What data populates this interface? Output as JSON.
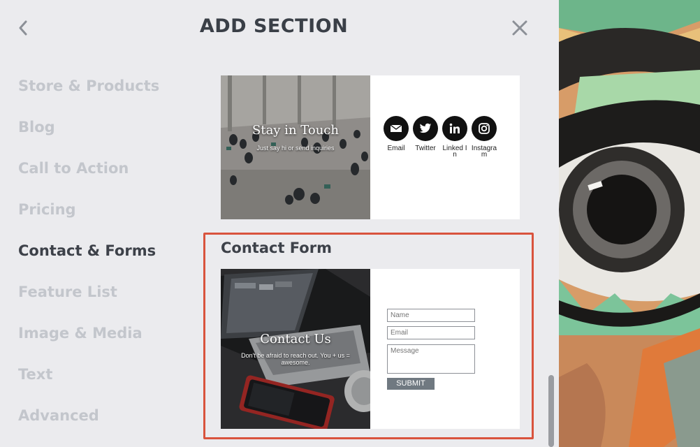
{
  "header": {
    "title": "ADD SECTION",
    "back_icon": "chevron-left-icon",
    "close_icon": "close-icon"
  },
  "categories": [
    {
      "label": "Store & Products",
      "active": false
    },
    {
      "label": "Blog",
      "active": false
    },
    {
      "label": "Call to Action",
      "active": false
    },
    {
      "label": "Pricing",
      "active": false
    },
    {
      "label": "Contact & Forms",
      "active": true
    },
    {
      "label": "Feature List",
      "active": false
    },
    {
      "label": "Image & Media",
      "active": false
    },
    {
      "label": "Text",
      "active": false
    },
    {
      "label": "Advanced",
      "active": false
    }
  ],
  "stay_in_touch": {
    "title": "Stay in Touch",
    "subtitle": "Just say hi or send inquiries",
    "socials": [
      {
        "label": "Email",
        "icon": "email-icon"
      },
      {
        "label": "Twitter",
        "icon": "twitter-icon"
      },
      {
        "label": "Linked In",
        "icon": "linkedin-icon"
      },
      {
        "label": "Instagram",
        "icon": "instagram-icon"
      }
    ]
  },
  "contact_form": {
    "section_title": "Contact Form",
    "image_title": "Contact Us",
    "image_subtitle": "Don't be afraid to reach out. You + us = awesome.",
    "name_placeholder": "Name",
    "email_placeholder": "Email",
    "message_placeholder": "Message",
    "submit_label": "SUBMIT"
  },
  "colors": {
    "panel_bg": "#ebebee",
    "selection_border": "#d9533d",
    "submit_bg": "#707981",
    "category_active": "#3d4149",
    "category_inactive": "#c3c6cc"
  }
}
